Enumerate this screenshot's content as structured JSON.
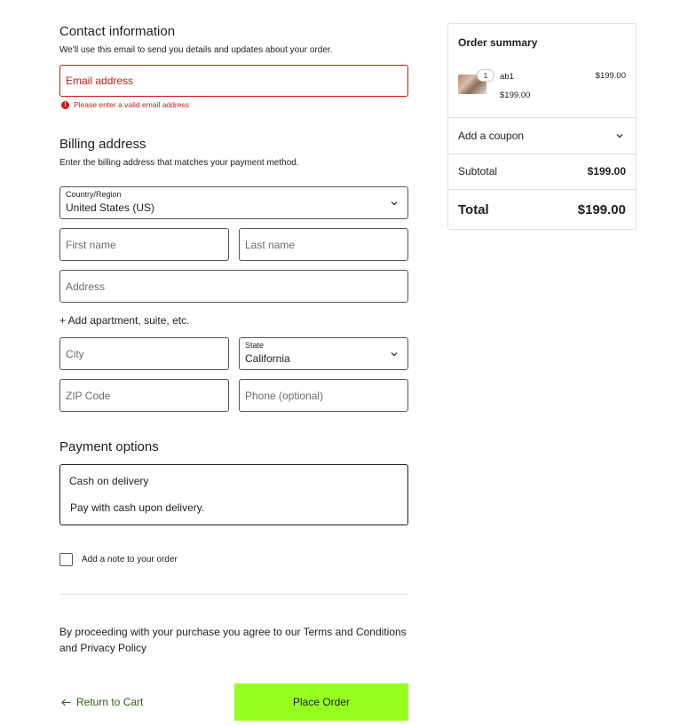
{
  "contact": {
    "title": "Contact information",
    "description": "We'll use this email to send you details and updates about your order.",
    "email_placeholder": "Email address",
    "email_error": "Please enter a valid email address"
  },
  "billing": {
    "title": "Billing address",
    "description": "Enter the billing address that matches your payment method.",
    "country_label": "Country/Region",
    "country_value": "United States (US)",
    "first_name_placeholder": "First name",
    "last_name_placeholder": "Last name",
    "address_placeholder": "Address",
    "add_apartment": "+ Add apartment, suite, etc.",
    "city_placeholder": "City",
    "state_label": "State",
    "state_value": "California",
    "zip_placeholder": "ZIP Code",
    "phone_placeholder": "Phone (optional)"
  },
  "payment": {
    "title": "Payment options",
    "method_title": "Cash on delivery",
    "method_desc": "Pay with cash upon delivery."
  },
  "note": {
    "label": "Add a note to your order"
  },
  "terms": {
    "text": "By proceeding with your purchase you agree to our Terms and Conditions and Privacy Policy"
  },
  "actions": {
    "return_label": "Return to Cart",
    "place_order_label": "Place Order"
  },
  "summary": {
    "title": "Order summary",
    "item": {
      "name": "ab1",
      "quantity": "1",
      "price": "$199.00",
      "line_price": "$199.00"
    },
    "coupon_label": "Add a coupon",
    "subtotal_label": "Subtotal",
    "subtotal_value": "$199.00",
    "total_label": "Total",
    "total_value": "$199.00"
  },
  "colors": {
    "error": "#cc1818",
    "accent_button": "#96ff1f",
    "link": "#2f5c14"
  }
}
